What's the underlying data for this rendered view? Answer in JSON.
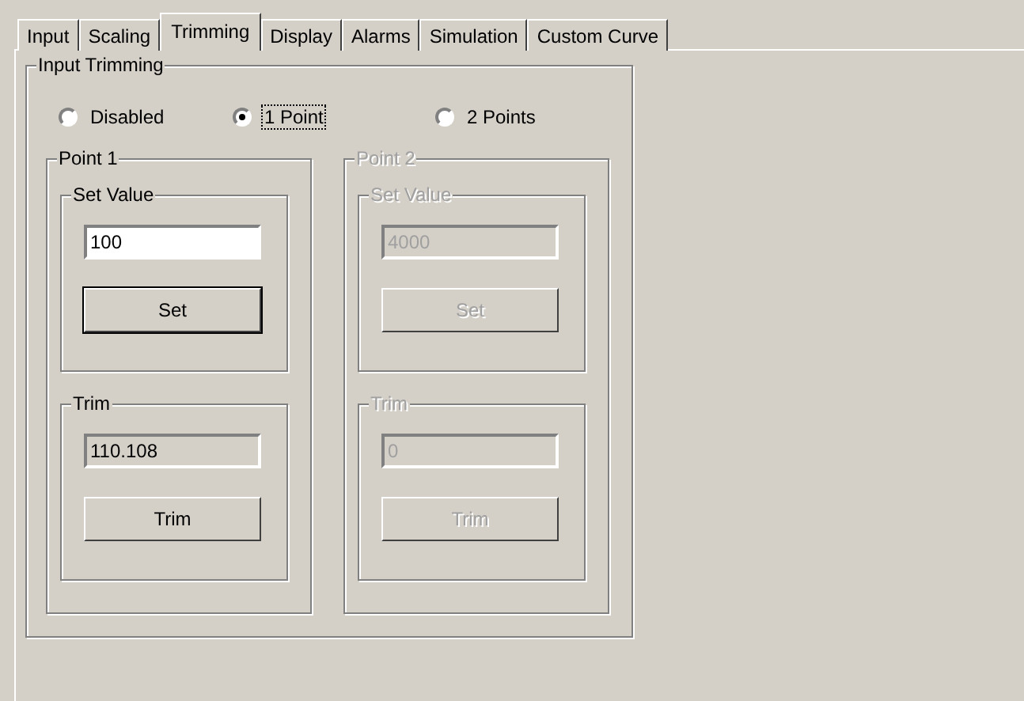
{
  "tabs": [
    {
      "label": "Input",
      "selected": false
    },
    {
      "label": "Scaling",
      "selected": false
    },
    {
      "label": "Trimming",
      "selected": true
    },
    {
      "label": "Display",
      "selected": false
    },
    {
      "label": "Alarms",
      "selected": false
    },
    {
      "label": "Simulation",
      "selected": false
    },
    {
      "label": "Custom Curve",
      "selected": false
    }
  ],
  "input_trimming": {
    "title": "Input Trimming",
    "modes": [
      {
        "label": "Disabled",
        "selected": false
      },
      {
        "label": "1 Point",
        "selected": true
      },
      {
        "label": "2 Points",
        "selected": false
      }
    ],
    "points": [
      {
        "title": "Point 1",
        "disabled": false,
        "set_value": {
          "title": "Set Value",
          "value": "100",
          "button": "Set"
        },
        "trim": {
          "title": "Trim",
          "value": "110.108",
          "button": "Trim"
        }
      },
      {
        "title": "Point 2",
        "disabled": true,
        "set_value": {
          "title": "Set Value",
          "value": "4000",
          "button": "Set"
        },
        "trim": {
          "title": "Trim",
          "value": "0",
          "button": "Trim"
        }
      }
    ]
  }
}
